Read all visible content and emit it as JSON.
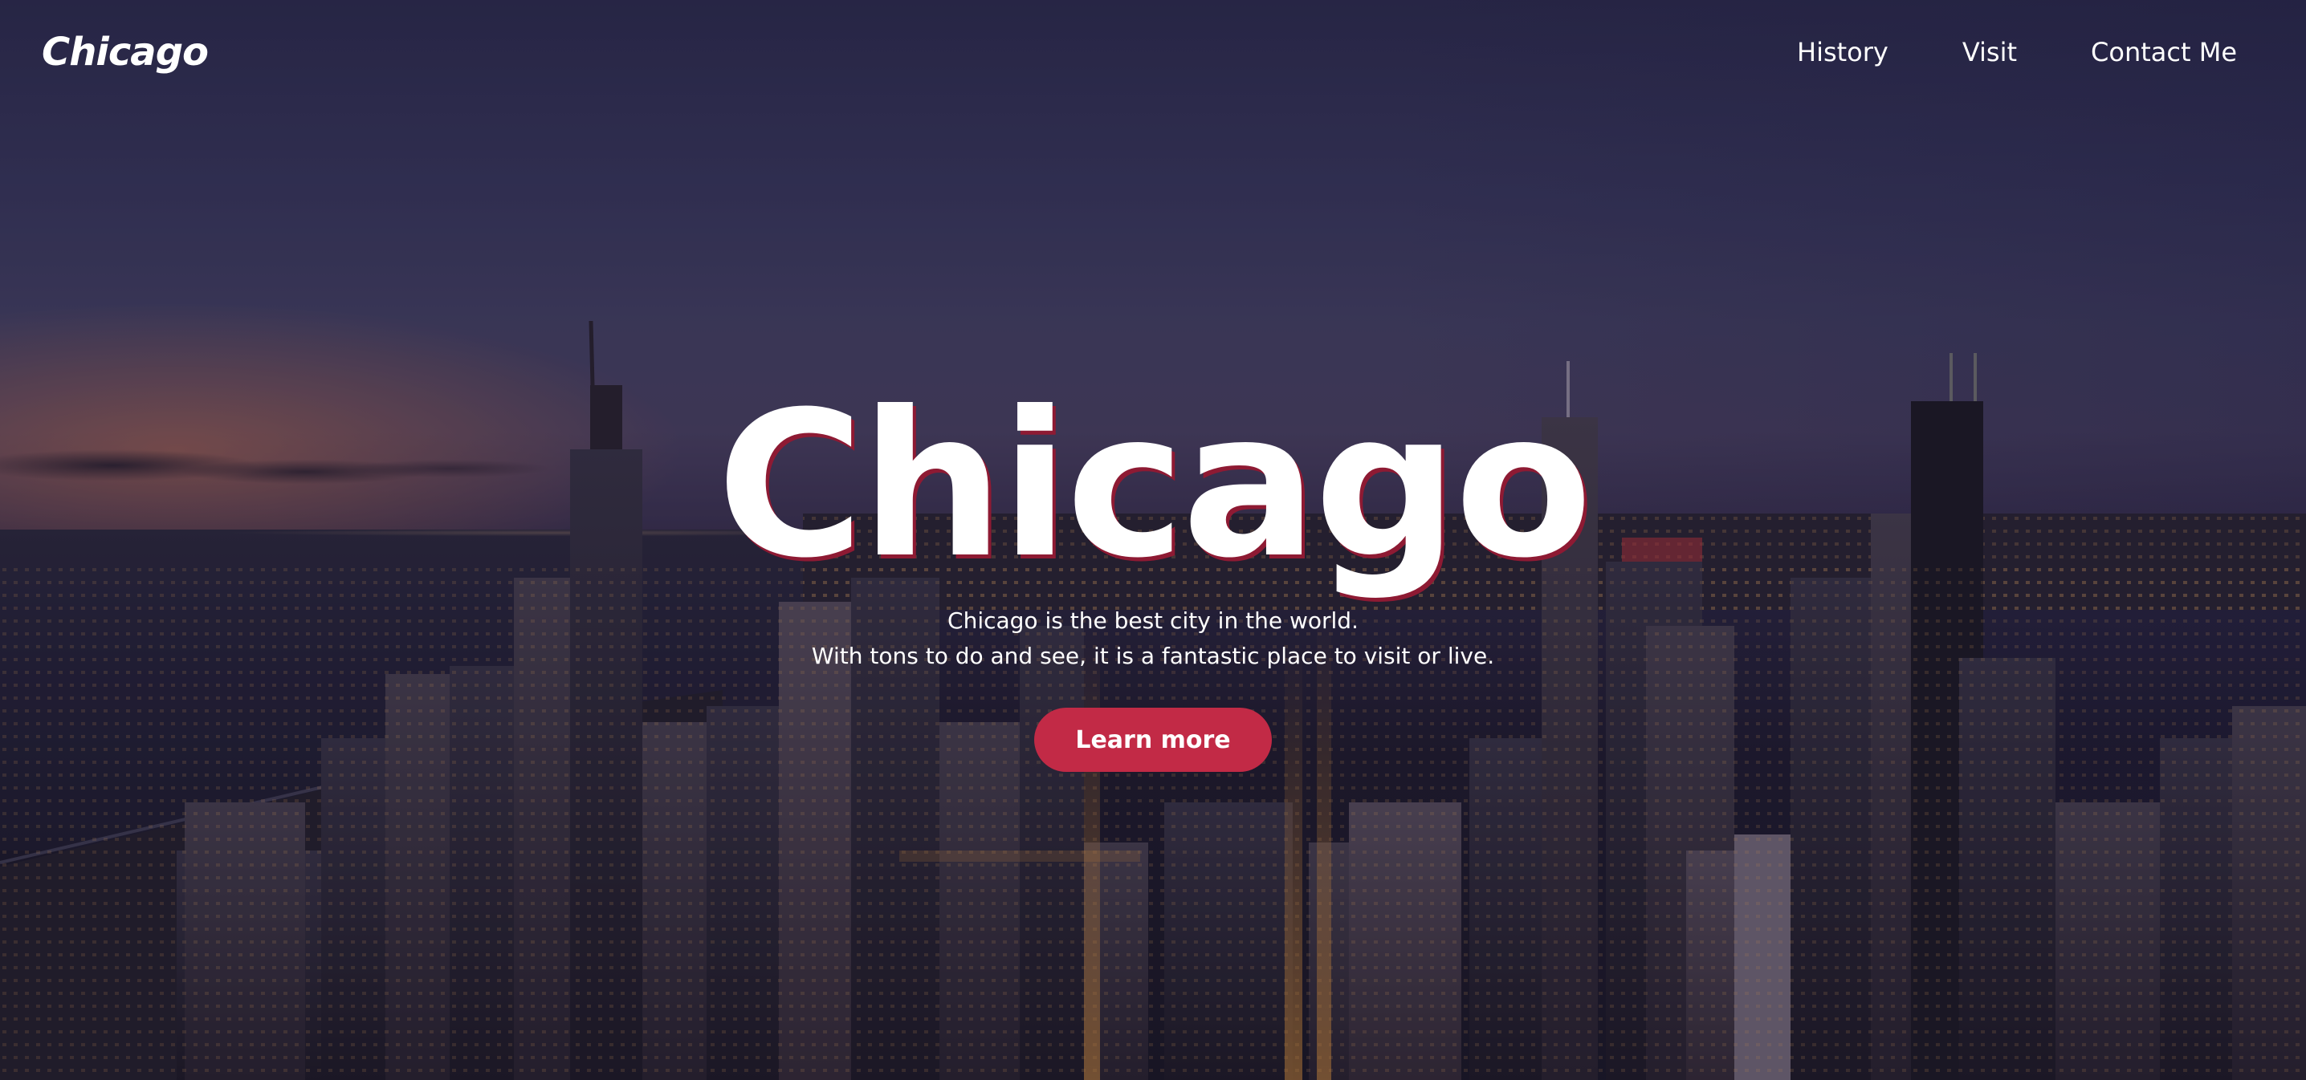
{
  "nav": {
    "brand": "Chicago",
    "links": [
      {
        "label": "History"
      },
      {
        "label": "Visit"
      },
      {
        "label": "Contact Me"
      }
    ]
  },
  "hero": {
    "title": "Chicago",
    "lines": [
      "Chicago is the best city in the world.",
      "With tons to do and see, it is a fantastic place to visit or live."
    ],
    "cta_label": "Learn more"
  },
  "colors": {
    "accent": "#c22a46",
    "title_shadow": "#8e1a33",
    "text": "#ffffff"
  }
}
